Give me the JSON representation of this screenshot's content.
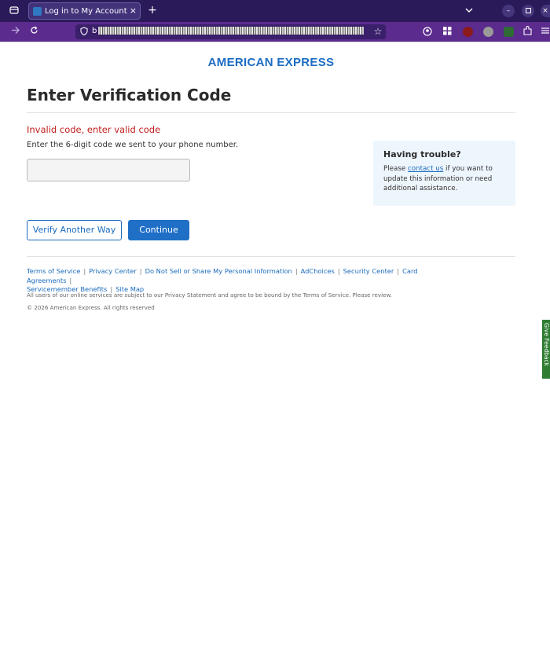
{
  "browser": {
    "tab_title": "Log in to My Account | American Express",
    "tab_close": "×",
    "new_tab": "+",
    "url_prefix": "b",
    "colors": {
      "tabbar": "#2b1a59",
      "navbar": "#5b2b8e"
    }
  },
  "icons": {
    "tab_overview": "tab-overview-icon",
    "close": "close-icon",
    "new_tab": "plus-icon",
    "dropdown": "chevron-down-icon",
    "minimize": "minimize-icon",
    "maximize": "maximize-icon",
    "back": "back-arrow-icon",
    "reload": "reload-icon",
    "shield": "shield-icon",
    "star": "star-icon",
    "account": "account-icon",
    "extensions": "extensions-icon",
    "menu": "hamburger-menu-icon"
  },
  "page": {
    "logo": "AMERICAN EXPRESS",
    "title": "Enter Verification Code",
    "error": "Invalid code, enter valid code",
    "instructions": "Enter the 6-digit code we sent to your phone number.",
    "code_input": {
      "value": "",
      "placeholder": ""
    },
    "trouble": {
      "title": "Having trouble?",
      "text_before": "Please ",
      "link": "contact us",
      "text_after": " if you want to update this information or need additional assistance."
    },
    "buttons": {
      "verify_another": "Verify Another Way",
      "continue": "Continue"
    }
  },
  "footer": {
    "links": [
      "Terms of Service",
      "Privacy Center",
      "Do Not Sell or Share My Personal Information",
      "AdChoices",
      "Security Center",
      "Card Agreements",
      "Servicemember Benefits",
      "Site Map"
    ],
    "separator": "|",
    "legal": "All users of our online services are subject to our Privacy Statement and agree to be bound by the Terms of Service. Please review.",
    "copyright": "© 2026 American Express. All rights reserved"
  },
  "feedback_tab": "Give Feedback",
  "colors": {
    "brand": "#1c6cc4",
    "error": "#c0201e",
    "trouble_bg": "#eef6fd",
    "feedback": "#2e7d32"
  }
}
